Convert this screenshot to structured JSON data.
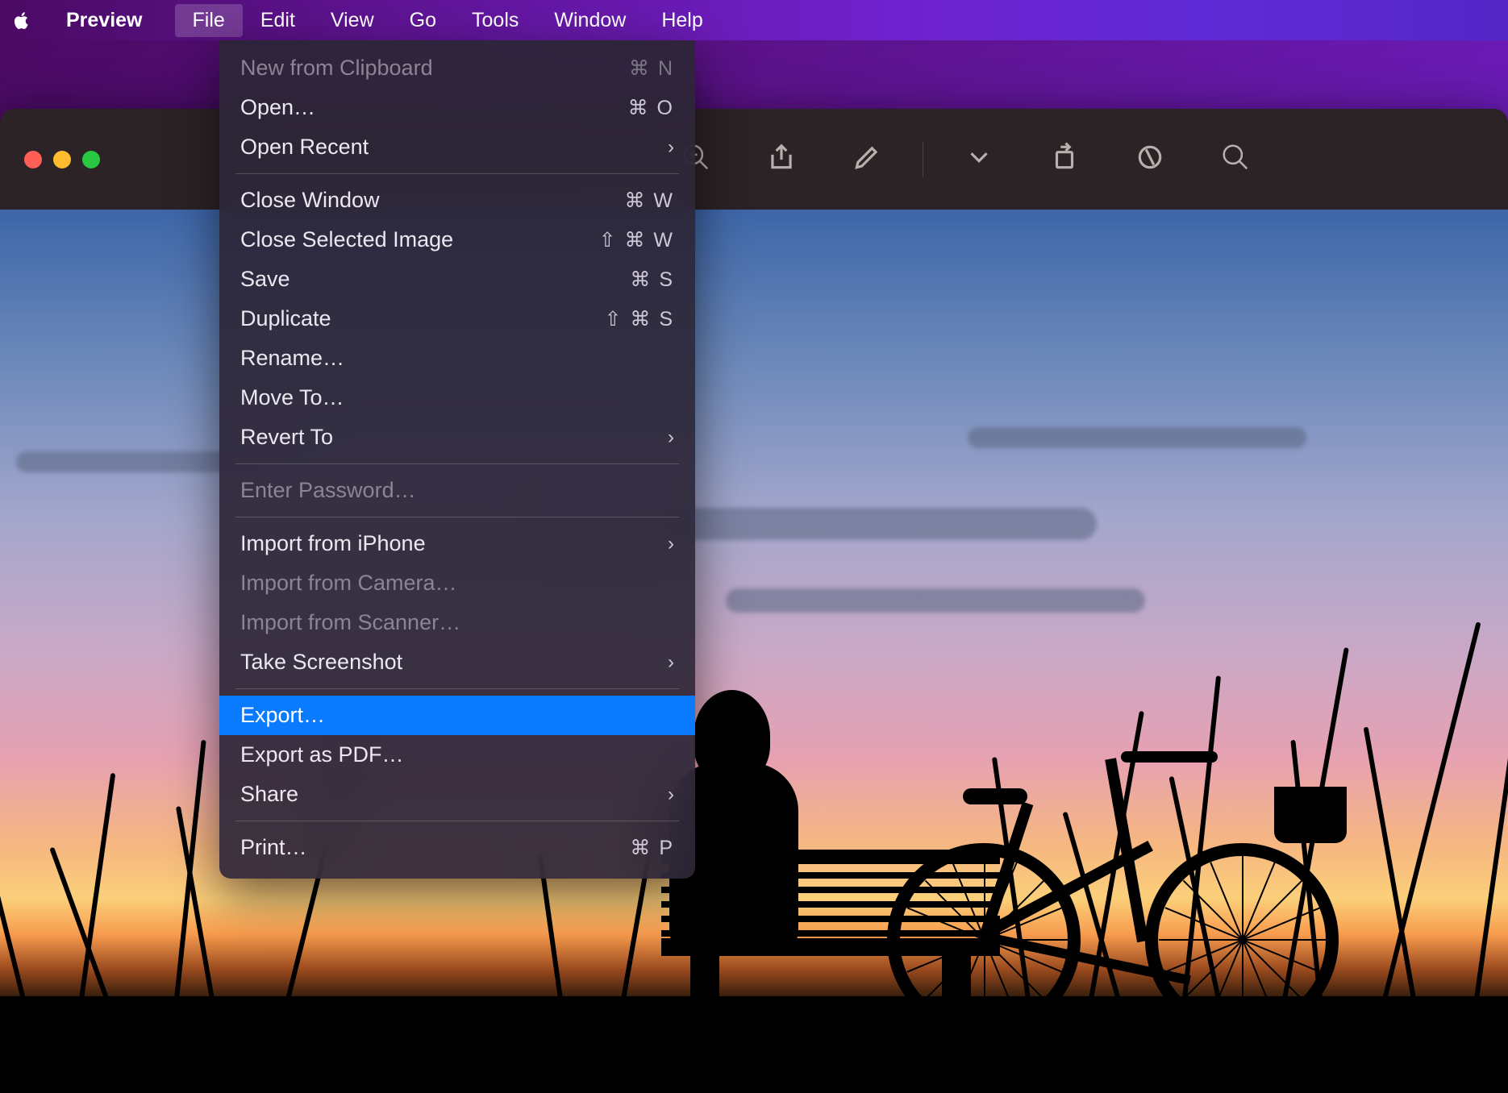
{
  "menubar": {
    "app_name": "Preview",
    "items": [
      {
        "label": "File",
        "active": true
      },
      {
        "label": "Edit"
      },
      {
        "label": "View"
      },
      {
        "label": "Go"
      },
      {
        "label": "Tools"
      },
      {
        "label": "Window"
      },
      {
        "label": "Help"
      }
    ]
  },
  "file_menu": {
    "groups": [
      [
        {
          "label": "New from Clipboard",
          "shortcut": "⌘ N",
          "disabled": true
        },
        {
          "label": "Open…",
          "shortcut": "⌘ O"
        },
        {
          "label": "Open Recent",
          "submenu": true
        }
      ],
      [
        {
          "label": "Close Window",
          "shortcut": "⌘ W"
        },
        {
          "label": "Close Selected Image",
          "shortcut": "⇧ ⌘ W"
        },
        {
          "label": "Save",
          "shortcut": "⌘ S"
        },
        {
          "label": "Duplicate",
          "shortcut": "⇧ ⌘ S"
        },
        {
          "label": "Rename…"
        },
        {
          "label": "Move To…"
        },
        {
          "label": "Revert To",
          "submenu": true
        }
      ],
      [
        {
          "label": "Enter Password…",
          "disabled": true
        }
      ],
      [
        {
          "label": "Import from iPhone",
          "submenu": true
        },
        {
          "label": "Import from Camera…",
          "disabled": true
        },
        {
          "label": "Import from Scanner…",
          "disabled": true
        },
        {
          "label": "Take Screenshot",
          "submenu": true
        }
      ],
      [
        {
          "label": "Export…",
          "highlight": true
        },
        {
          "label": "Export as PDF…"
        },
        {
          "label": "Share",
          "submenu": true
        }
      ],
      [
        {
          "label": "Print…",
          "shortcut": "⌘ P"
        }
      ]
    ]
  },
  "toolbar_icons": [
    "zoom-out-icon",
    "zoom-in-icon",
    "share-icon",
    "markup-icon",
    "dropdown-chevron-icon",
    "rotate-icon",
    "highlight-icon",
    "search-icon"
  ]
}
